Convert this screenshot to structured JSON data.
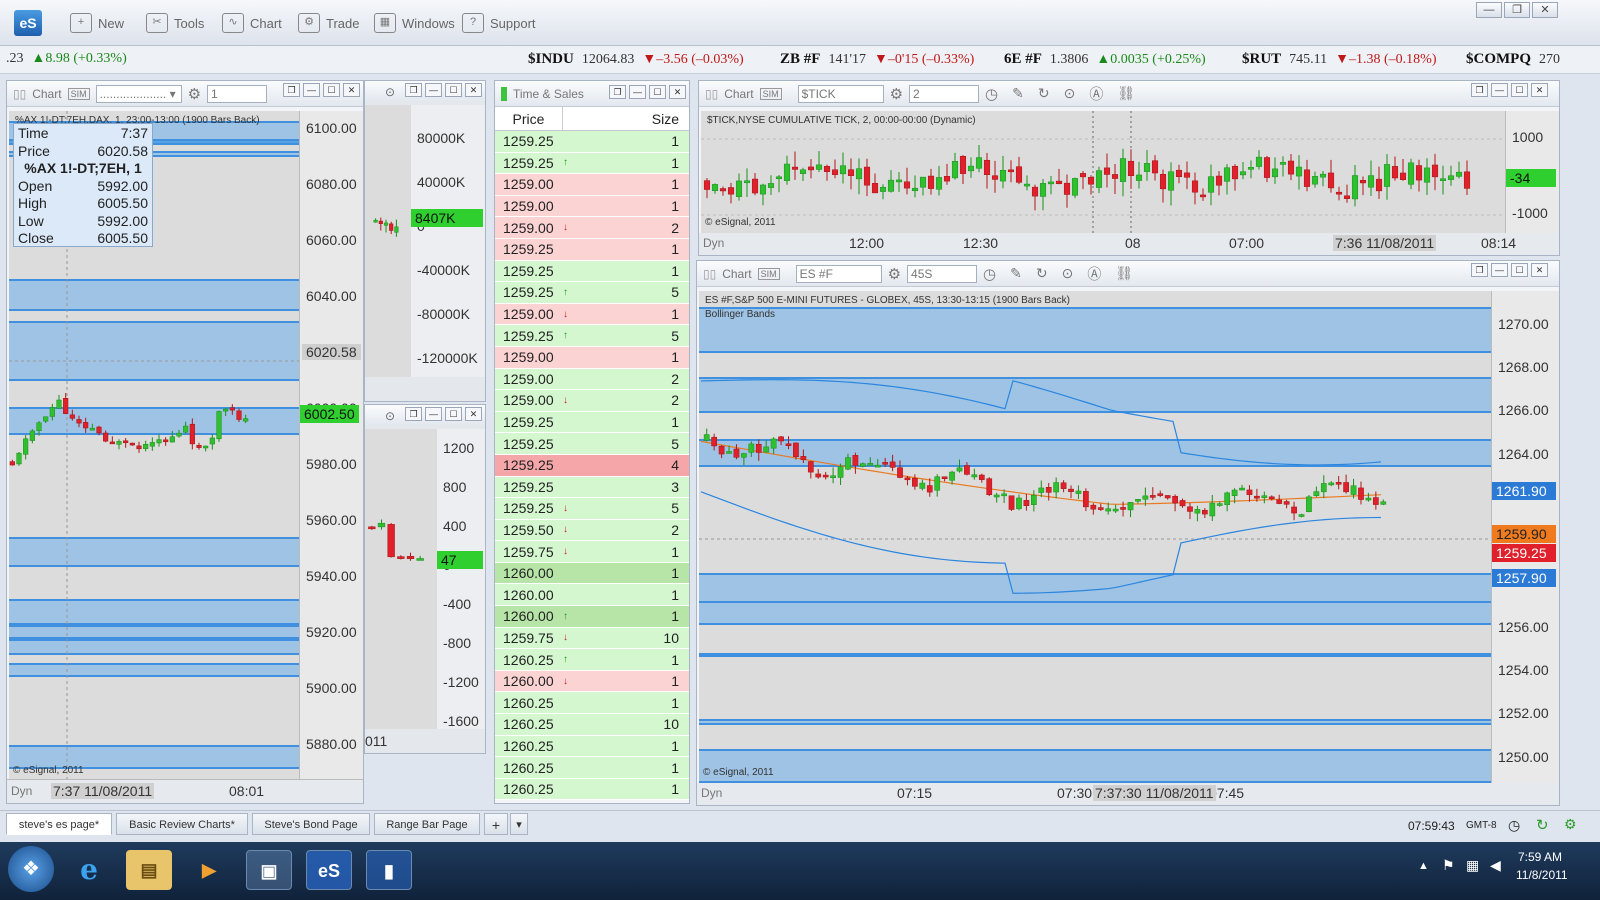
{
  "app": {
    "logo": "eS"
  },
  "menu": [
    {
      "label": "New",
      "icon": "new-icon",
      "glyph": "+"
    },
    {
      "label": "Tools",
      "icon": "tools-icon",
      "glyph": "✂"
    },
    {
      "label": "Chart",
      "icon": "chart-icon",
      "glyph": "∿"
    },
    {
      "label": "Trade",
      "icon": "trade-icon",
      "glyph": "⚙"
    },
    {
      "label": "Windows",
      "icon": "windows-icon",
      "glyph": "▦"
    },
    {
      "label": "Support",
      "icon": "support-icon",
      "glyph": "?"
    }
  ],
  "ticker": [
    {
      "sym": "",
      "price": ".23",
      "chg": "▲8.98 (+0.33%)",
      "dir": "up"
    },
    {
      "sym": "$INDU",
      "price": "12064.83",
      "chg": "▼–3.56 (–0.03%)",
      "dir": "dn"
    },
    {
      "sym": "ZB #F",
      "price": "141'17",
      "chg": "▼–0'15 (–0.33%)",
      "dir": "dn"
    },
    {
      "sym": "6E #F",
      "price": "1.3806",
      "chg": "▲0.0035 (+0.25%)",
      "dir": "up"
    },
    {
      "sym": "$RUT",
      "price": "745.11",
      "chg": "▼–1.38 (–0.18%)",
      "dir": "dn"
    },
    {
      "sym": "$COMPQ",
      "price": "270",
      "chg": "",
      "dir": "up"
    }
  ],
  "left_chart": {
    "title": "Chart",
    "interval_field": "1",
    "symbol_line": "%AX 1!-DT;7EH,DAX, 1, 23:00-13:00 (1900 Bars Back)",
    "crosshair": {
      "time_label": "Time",
      "time": "7:37",
      "price_label": "Price",
      "price": "6020.58",
      "symbol": "%AX 1!-DT;7EH, 1",
      "open_label": "Open",
      "open": "5992.00",
      "high_label": "High",
      "high": "6005.50",
      "low_label": "Low",
      "low": "5992.00",
      "close_label": "Close",
      "close": "6005.50"
    },
    "axis": [
      "6100.00",
      "6080.00",
      "6060.00",
      "6040.00",
      "6020.58",
      "6000.00",
      "5980.00",
      "5960.00",
      "5940.00",
      "5920.00",
      "5900.00",
      "5880.00"
    ],
    "last_tag": "6002.50",
    "cursor_tag": "6020.58",
    "copyright": "© eSignal, 2011",
    "dyn": "Dyn",
    "time_cursor": "7:37 11/08/2011",
    "time_label": "08:01"
  },
  "mid_top": {
    "axis": [
      "80000K",
      "40000K",
      "0",
      "-40000K",
      "-80000K",
      "-120000K"
    ],
    "tag": "8407K"
  },
  "mid_bottom": {
    "axis": [
      "1200",
      "800",
      "400",
      "0",
      "-400",
      "-800",
      "-1200",
      "-1600"
    ],
    "tag": "47",
    "time_fragment": "011"
  },
  "time_sales": {
    "title": "Time & Sales",
    "col_price": "Price",
    "col_size": "Size",
    "rows": [
      {
        "p": "1259.25",
        "a": "",
        "s": "1",
        "c": "g"
      },
      {
        "p": "1259.25",
        "a": "↑",
        "s": "1",
        "c": "g"
      },
      {
        "p": "1259.00",
        "a": "",
        "s": "1",
        "c": "r"
      },
      {
        "p": "1259.00",
        "a": "",
        "s": "1",
        "c": "r"
      },
      {
        "p": "1259.00",
        "a": "↓",
        "s": "2",
        "c": "r"
      },
      {
        "p": "1259.25",
        "a": "",
        "s": "1",
        "c": "r"
      },
      {
        "p": "1259.25",
        "a": "",
        "s": "1",
        "c": "g"
      },
      {
        "p": "1259.25",
        "a": "↑",
        "s": "5",
        "c": "g"
      },
      {
        "p": "1259.00",
        "a": "↓",
        "s": "1",
        "c": "r"
      },
      {
        "p": "1259.25",
        "a": "↑",
        "s": "5",
        "c": "g"
      },
      {
        "p": "1259.00",
        "a": "",
        "s": "1",
        "c": "r"
      },
      {
        "p": "1259.00",
        "a": "",
        "s": "2",
        "c": "g"
      },
      {
        "p": "1259.00",
        "a": "↓",
        "s": "2",
        "c": "g"
      },
      {
        "p": "1259.25",
        "a": "",
        "s": "1",
        "c": "g"
      },
      {
        "p": "1259.25",
        "a": "",
        "s": "5",
        "c": "g"
      },
      {
        "p": "1259.25",
        "a": "",
        "s": "4",
        "c": "R"
      },
      {
        "p": "1259.25",
        "a": "",
        "s": "3",
        "c": "g"
      },
      {
        "p": "1259.25",
        "a": "↓",
        "s": "5",
        "c": "g"
      },
      {
        "p": "1259.50",
        "a": "↓",
        "s": "2",
        "c": "g"
      },
      {
        "p": "1259.75",
        "a": "↓",
        "s": "1",
        "c": "g"
      },
      {
        "p": "1260.00",
        "a": "",
        "s": "1",
        "c": "G"
      },
      {
        "p": "1260.00",
        "a": "",
        "s": "1",
        "c": "g"
      },
      {
        "p": "1260.00",
        "a": "↑",
        "s": "1",
        "c": "G"
      },
      {
        "p": "1259.75",
        "a": "↓",
        "s": "10",
        "c": "g"
      },
      {
        "p": "1260.25",
        "a": "↑",
        "s": "1",
        "c": "g"
      },
      {
        "p": "1260.00",
        "a": "↓",
        "s": "1",
        "c": "r"
      },
      {
        "p": "1260.25",
        "a": "",
        "s": "1",
        "c": "g"
      },
      {
        "p": "1260.25",
        "a": "",
        "s": "10",
        "c": "g"
      },
      {
        "p": "1260.25",
        "a": "",
        "s": "1",
        "c": "g"
      },
      {
        "p": "1260.25",
        "a": "",
        "s": "1",
        "c": "g"
      },
      {
        "p": "1260.25",
        "a": "",
        "s": "1",
        "c": "g"
      }
    ]
  },
  "tick_chart": {
    "title": "Chart",
    "symbol_field": "$TICK",
    "interval_field": "2",
    "symbol_line": "$TICK,NYSE CUMULATIVE TICK, 2, 00:00-00:00 (Dynamic)",
    "axis": [
      "1000",
      "-1000"
    ],
    "tag": "-34",
    "copyright": "© eSignal, 2011",
    "dyn": "Dyn",
    "times": [
      "12:00",
      "12:30",
      "08",
      "07:00",
      "08:14"
    ],
    "time_cursor": "7:36 11/08/2011"
  },
  "es_chart": {
    "title": "Chart",
    "symbol_field": "ES #F",
    "interval_field": "45S",
    "symbol_line": "ES #F,S&P 500 E-MINI FUTURES - GLOBEX, 45S, 13:30-13:15 (1900 Bars Back)",
    "study": "Bollinger Bands",
    "axis": [
      "1270.00",
      "1268.00",
      "1266.00",
      "1264.00",
      "1262.00",
      "1260.00",
      "1258.00",
      "1256.00",
      "1254.00",
      "1252.00",
      "1250.00"
    ],
    "tags": [
      {
        "v": "1261.90",
        "bg": "#2a7ad6",
        "fg": "#ffffff"
      },
      {
        "v": "1259.90",
        "bg": "#f07a1e",
        "fg": "#222222"
      },
      {
        "v": "1259.25",
        "bg": "#e0202a",
        "fg": "#ffffff"
      },
      {
        "v": "1257.90",
        "bg": "#2a7ad6",
        "fg": "#ffffff"
      }
    ],
    "copyright": "© eSignal, 2011",
    "dyn": "Dyn",
    "times": [
      "07:15",
      "07:30",
      "07:45"
    ],
    "time_cursor": "7:37:30 11/08/2011"
  },
  "tabs": [
    "steve's es page*",
    "Basic Review Charts*",
    "Steve's Bond Page",
    "Range Bar Page"
  ],
  "status": {
    "clock": "07:59:43",
    "tz": "GMT-8"
  },
  "taskbar": {
    "time": "7:59 AM",
    "date": "11/8/2011"
  },
  "colors": {
    "up": "#2fbf2f",
    "down": "#e0202a",
    "band": "#6eafeb",
    "band_line": "#3f90de",
    "ts_green": "#d4f7d0",
    "ts_red": "#fbd3d3"
  }
}
